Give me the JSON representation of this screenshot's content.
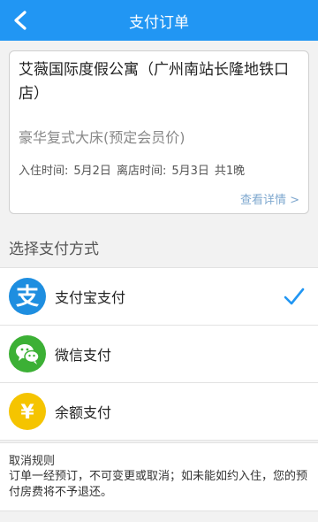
{
  "header": {
    "title": "支付订单",
    "back_icon": "chevron-left-icon"
  },
  "order": {
    "hotel_name": "艾薇国际度假公寓（广州南站长隆地铁口店）",
    "room_type": "豪华复式大床(预定会员价)",
    "checkin_label": "入住时间:",
    "checkin_date": "5月2日",
    "checkout_label": "离店时间:",
    "checkout_date": "5月3日",
    "nights": "共1晚",
    "detail_link": "查看详情 >"
  },
  "payment": {
    "section_title": "选择支付方式",
    "methods": [
      {
        "label": "支付宝支付",
        "icon": "alipay-icon",
        "color": "#1e8ee0",
        "selected": true
      },
      {
        "label": "微信支付",
        "icon": "wechat-icon",
        "color": "#3cb035",
        "selected": false
      },
      {
        "label": "余额支付",
        "icon": "yen-icon",
        "color": "#f5c400",
        "selected": false
      }
    ]
  },
  "cancel_policy": {
    "title": "取消规则",
    "text": "订单一经预订，不可变更或取消；如未能如约入住，您的预付房费将不予退还。"
  },
  "colors": {
    "brand": "#2196f3",
    "link": "#7fa8cf"
  }
}
